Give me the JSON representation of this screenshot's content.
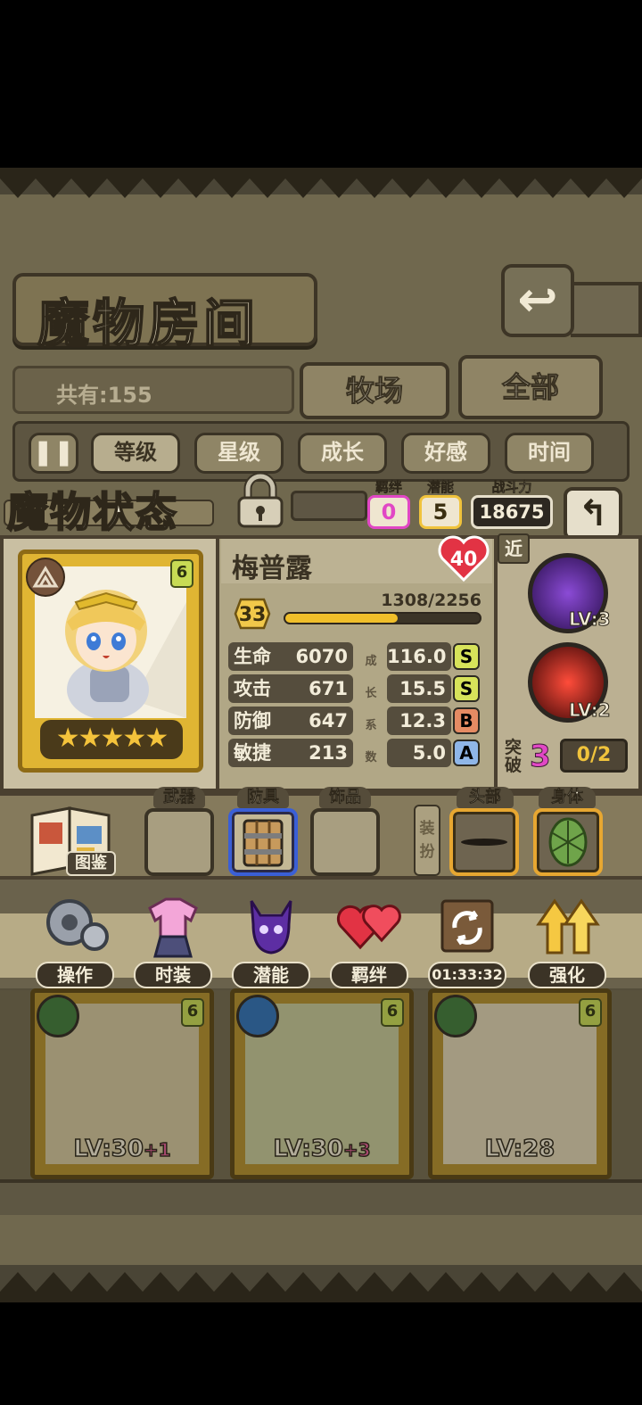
{
  "header": {
    "title": "魔物房间",
    "back_icon": "return-arrow-icon"
  },
  "collection": {
    "count_text": "共有:155"
  },
  "filters": {
    "ranch": "牧场",
    "all": "全部"
  },
  "sort": {
    "toggle_icon": "pause-toggle-icon",
    "options": [
      "等级",
      "星级",
      "成长",
      "好感",
      "时间"
    ],
    "active": "等级"
  },
  "status": {
    "title": "魔物状态",
    "lock_icon": "padlock-icon",
    "bond": {
      "label": "羁绊",
      "value": "0"
    },
    "potential": {
      "label": "潜能",
      "value": "5"
    },
    "power": {
      "label": "战斗力",
      "value": "18675"
    }
  },
  "monster": {
    "name": "梅普露",
    "tier": "6",
    "stars": "★★★★★",
    "heart_level": "40",
    "level": "33",
    "exp_text": "1308/2256",
    "exp_fraction": 0.58,
    "growth_label_chars": [
      "成",
      "长",
      "系",
      "数"
    ],
    "stats": [
      {
        "name": "生命",
        "value": "6070",
        "growth": "116.0",
        "grade": "S",
        "grade_color": "#d7e35a"
      },
      {
        "name": "攻击",
        "value": "671",
        "growth": "15.5",
        "grade": "S",
        "grade_color": "#d7e35a"
      },
      {
        "name": "防御",
        "value": "647",
        "growth": "12.3",
        "grade": "B",
        "grade_color": "#e58b63"
      },
      {
        "name": "敏捷",
        "value": "213",
        "growth": "5.0",
        "grade": "A",
        "grade_color": "#8fb6e8"
      }
    ],
    "range_tag": "近",
    "skills": [
      {
        "level": "LV:3",
        "color": "#5b2a9a"
      },
      {
        "level": "LV:2",
        "color": "#b8191c"
      }
    ],
    "breakthrough": {
      "label": "突破",
      "value": "3",
      "progress": "0/2"
    }
  },
  "equipment": {
    "codex_label": "图鉴",
    "weapon_label": "武器",
    "armor_label": "防具",
    "accessory_label": "饰品",
    "dress_label": "装扮",
    "head_label": "头部",
    "body_label": "身体"
  },
  "actions": [
    {
      "label": "操作",
      "icon": "gear-icon"
    },
    {
      "label": "时装",
      "icon": "outfit-icon"
    },
    {
      "label": "潜能",
      "icon": "demon-icon"
    },
    {
      "label": "羁绊",
      "icon": "hearts-icon"
    },
    {
      "label": "01:33:32",
      "icon": "refresh-icon"
    },
    {
      "label": "强化",
      "icon": "upgrade-arrows-icon"
    }
  ],
  "roster": [
    {
      "level": "LV:30",
      "plus": "+1",
      "tier": "6",
      "element": "grass"
    },
    {
      "level": "LV:30",
      "plus": "+3",
      "tier": "6",
      "element": "water"
    },
    {
      "level": "LV:28",
      "plus": "",
      "tier": "6",
      "element": "grass"
    }
  ],
  "colors": {
    "accent_gold": "#f0bf2a",
    "bond_pink": "#e147c5",
    "potential_yellow": "#f0c33c",
    "armor_blue": "#3a5fd6"
  }
}
